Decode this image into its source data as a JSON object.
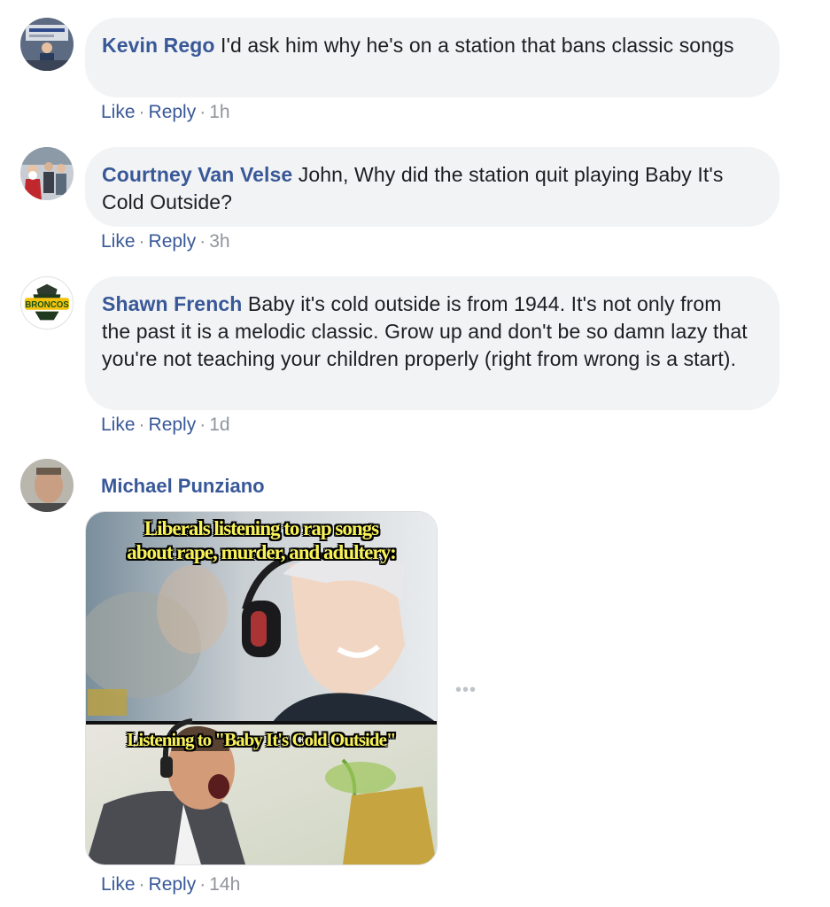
{
  "comments": [
    {
      "author": "Kevin Rego",
      "text": "I'd ask him why he's on a station that bans classic songs",
      "like_label": "Like",
      "reply_label": "Reply",
      "separator": "·",
      "time": "1h"
    },
    {
      "author": "Courtney Van Velse",
      "text": "John, Why did the station quit playing Baby It's Cold Outside?",
      "like_label": "Like",
      "reply_label": "Reply",
      "separator": "·",
      "time": "3h"
    },
    {
      "author": "Shawn French",
      "text": "Baby it's cold outside is from 1944. It's not only from the past it is a melodic classic. Grow up and don't be so damn lazy that you're not teaching your children properly (right from wrong is a start).",
      "like_label": "Like",
      "reply_label": "Reply",
      "separator": "·",
      "time": "1d"
    },
    {
      "author": "Michael Punziano",
      "like_label": "Like",
      "reply_label": "Reply",
      "separator": "·",
      "time": "14h",
      "meme": {
        "caption_top_line1": "Liberals listening to rap songs",
        "caption_top_line2": "about rape, murder, and adultery:",
        "caption_bottom": "Listening to \"Baby It's Cold Outside\""
      }
    }
  ],
  "more_options_label": "•••",
  "logo_text": "BRONCOS",
  "colors": {
    "link": "#385898",
    "bubble": "#f2f3f5",
    "meta": "#90949c",
    "meme_caption": "#f7f15a"
  }
}
